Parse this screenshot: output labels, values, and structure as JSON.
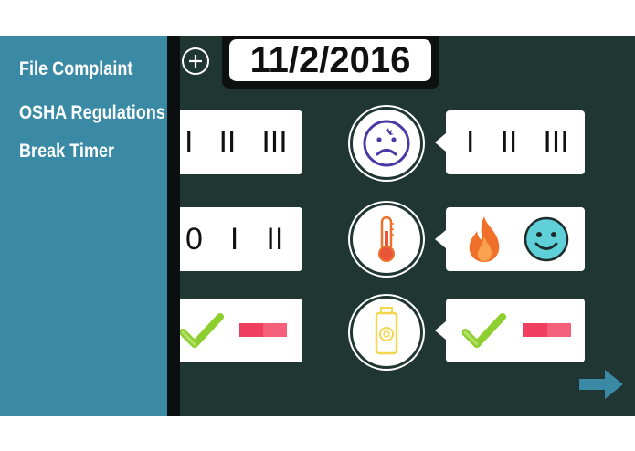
{
  "sidebar": {
    "items": [
      {
        "label": "File Complaint"
      },
      {
        "label": "OSHA Regulations"
      },
      {
        "label": "Break Timer"
      }
    ]
  },
  "header": {
    "date": "11/2/2016"
  },
  "rows": [
    {
      "left_counts": [
        "I",
        "II",
        "III"
      ],
      "status_icon": "sad-face-icon",
      "right_counts": [
        "I",
        "II",
        "III"
      ]
    },
    {
      "left_counts": [
        "0",
        "I",
        "II"
      ],
      "status_icon": "thermometer-icon",
      "right_icons": [
        "flame-icon",
        "smiley-face-icon"
      ]
    },
    {
      "status_icon": "water-bottle-icon",
      "left_icons": [
        "check-icon",
        "progress-bar"
      ],
      "right_icons": [
        "check-icon",
        "progress-bar"
      ],
      "left_progress": 0.5,
      "right_progress": 0.5
    }
  ],
  "colors": {
    "board": "#1f3632",
    "sidebar": "#3a8aa6",
    "accent_green": "#8ccf2e",
    "accent_red": "#f03f5f",
    "arrow": "#3a8aa6",
    "icon_purple": "#4a3aa6",
    "flame": "#f0702a",
    "smiley": "#5fd0d8",
    "bottle": "#f2d64e"
  }
}
